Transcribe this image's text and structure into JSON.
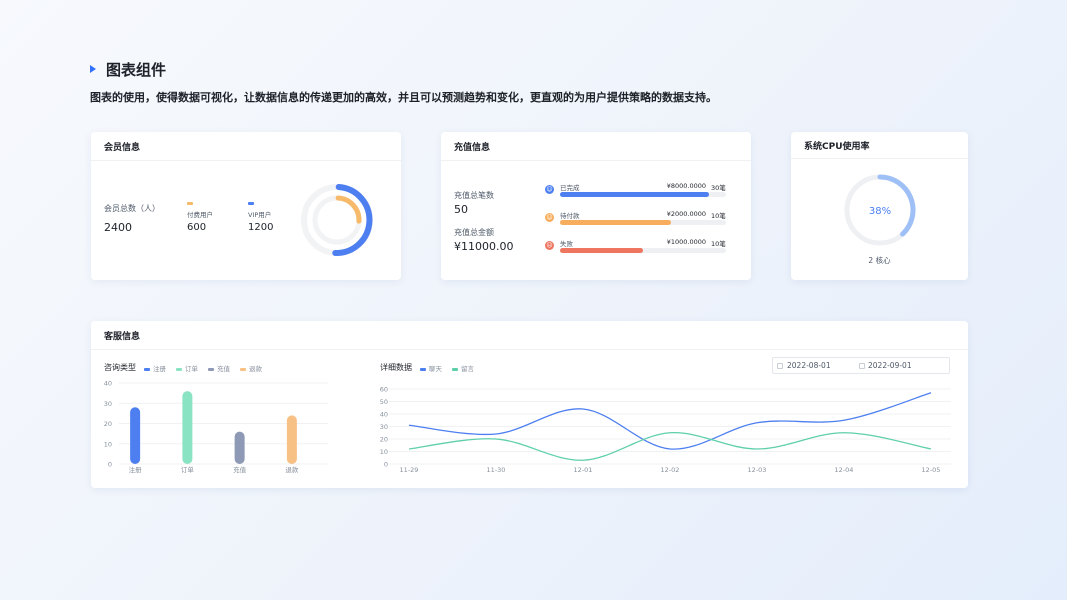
{
  "header": {
    "title": "图表组件",
    "description": "图表的使用，使得数据可视化，让数据信息的传递更加的高效，并且可以预测趋势和变化，更直观的为用户提供策略的数据支持。"
  },
  "member": {
    "title": "会员信息",
    "total_label": "会员总数（人）",
    "total_value": "2400",
    "paid_label": "付费用户",
    "paid_value": "600",
    "vip_label": "VIP用户",
    "vip_value": "1200",
    "paid_color": "#f7ba6b",
    "vip_color": "#4d7ff0",
    "donut": {
      "paid": 600,
      "vip": 1200,
      "total": 2400
    }
  },
  "recharge": {
    "title": "充值信息",
    "count_label": "充值总笔数",
    "count_value": "50",
    "amount_label": "充值总金额",
    "amount_value": "¥11000.00",
    "rows": [
      {
        "status": "已完成",
        "amount": "¥8000.0000",
        "count": "30笔",
        "ratio": 0.9,
        "color": "#4d7ff0",
        "icon": "smile-icon",
        "glyph": "☺"
      },
      {
        "status": "待付款",
        "amount": "¥2000.0000",
        "count": "10笔",
        "ratio": 0.67,
        "color": "#f7ad5c",
        "icon": "neutral-face-icon",
        "glyph": "☺"
      },
      {
        "status": "失败",
        "amount": "¥1000.0000",
        "count": "10笔",
        "ratio": 0.5,
        "color": "#ee7560",
        "icon": "sad-face-icon",
        "glyph": "☹"
      }
    ]
  },
  "cpu": {
    "title": "系统CPU使用率",
    "percent_label": "38%",
    "percent": 0.38,
    "cores": "2 核心"
  },
  "service": {
    "title": "客服信息",
    "left_title": "咨询类型",
    "right_title": "详细数据",
    "date_start": "2022-08-01",
    "date_end": "2022-09-01"
  },
  "chart_data": [
    {
      "type": "bar",
      "title": "咨询类型",
      "categories": [
        "注册",
        "订单",
        "充值",
        "退款"
      ],
      "values": [
        28,
        36,
        16,
        24
      ],
      "colors": [
        "#4d7ff0",
        "#8ae3c2",
        "#8e9ab5",
        "#f7c185"
      ],
      "legend": [
        "注册",
        "订单",
        "充值",
        "退款"
      ],
      "yticks": [
        "0",
        "10",
        "20",
        "30",
        "40"
      ],
      "ylim": [
        0,
        40
      ],
      "grid": true,
      "legend_position": "top"
    },
    {
      "type": "line",
      "title": "详细数据",
      "categories": [
        "11-29",
        "11-30",
        "12-01",
        "12-02",
        "12-03",
        "12-04",
        "12-05"
      ],
      "series": [
        {
          "name": "聊天",
          "values": [
            31,
            24,
            44,
            12,
            33,
            35,
            57
          ],
          "color": "#4d7ff0"
        },
        {
          "name": "留言",
          "values": [
            12,
            20,
            3,
            25,
            12,
            25,
            12
          ],
          "color": "#5ecfab"
        }
      ],
      "yticks": [
        "0",
        "10",
        "20",
        "30",
        "40",
        "50",
        "60"
      ],
      "ylim": [
        0,
        60
      ],
      "grid": true,
      "legend_position": "top"
    }
  ]
}
